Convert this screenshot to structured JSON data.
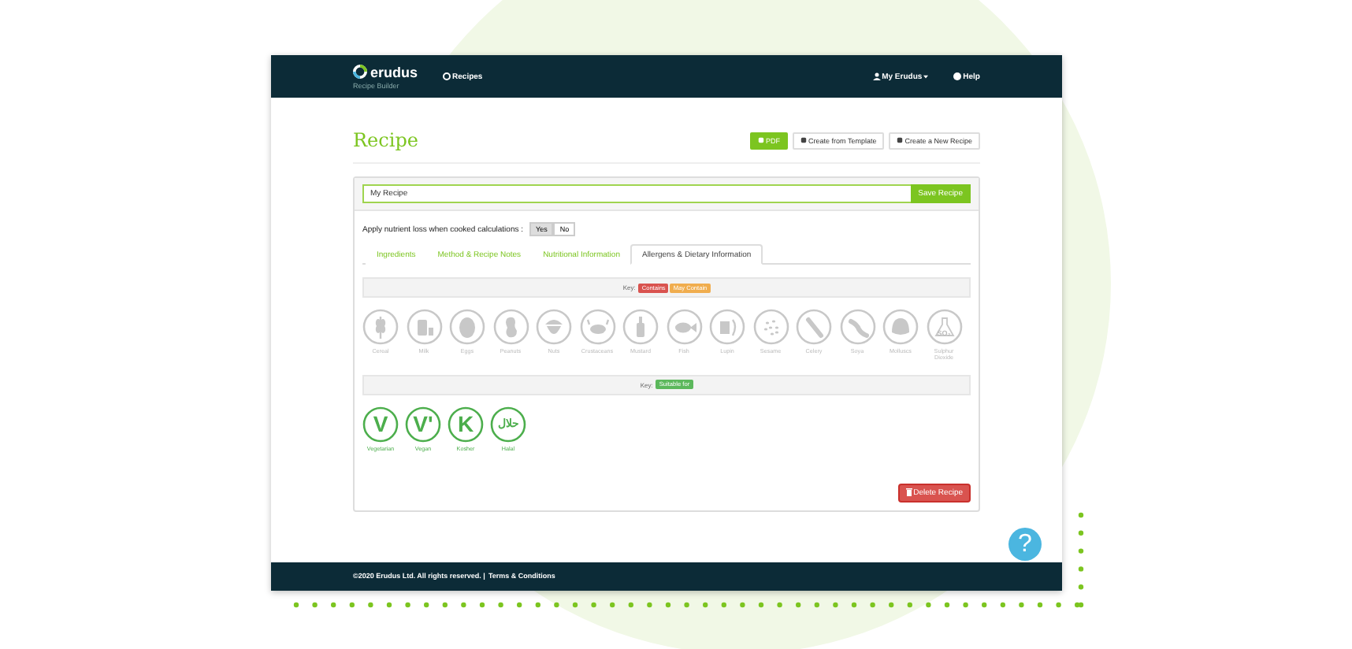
{
  "header": {
    "brand": "erudus",
    "subtitle": "Recipe Builder",
    "nav": [
      {
        "label": "Recipes"
      }
    ],
    "user_menu": "My Erudus",
    "help": "Help"
  },
  "page": {
    "title": "Recipe",
    "actions": [
      {
        "label": "PDF",
        "kind": "primary"
      },
      {
        "label": "Create from Template",
        "kind": "default"
      },
      {
        "label": "Create a New Recipe",
        "kind": "default"
      }
    ]
  },
  "recipe": {
    "name": "My Recipe",
    "save": "Save Recipe"
  },
  "nutrient_loss": {
    "label": "Apply nutrient loss when cooked calculations :",
    "options": [
      {
        "label": "Yes",
        "selected": true
      },
      {
        "label": "No",
        "selected": false
      }
    ]
  },
  "tabs": [
    {
      "label": "Ingredients",
      "selected": false
    },
    {
      "label": "Method & Recipe Notes",
      "selected": false
    },
    {
      "label": "Nutritional Information",
      "selected": false
    },
    {
      "label": "Allergens & Dietary Information",
      "selected": true
    }
  ],
  "allergen_key": {
    "label": "Key:",
    "tags": [
      {
        "label": "Contains",
        "color": "#d9534f"
      },
      {
        "label": "May Contain",
        "color": "#f0ad4e"
      }
    ]
  },
  "allergens": [
    {
      "label": "Cereal",
      "kind": "cereal"
    },
    {
      "label": "Milk",
      "kind": "milk"
    },
    {
      "label": "Eggs",
      "kind": "eggs"
    },
    {
      "label": "Peanuts",
      "kind": "peanuts"
    },
    {
      "label": "Nuts",
      "kind": "nuts"
    },
    {
      "label": "Crustaceans",
      "kind": "crustaceans"
    },
    {
      "label": "Mustard",
      "kind": "mustard"
    },
    {
      "label": "Fish",
      "kind": "fish"
    },
    {
      "label": "Lupin",
      "kind": "lupin"
    },
    {
      "label": "Sesame",
      "kind": "sesame"
    },
    {
      "label": "Celery",
      "kind": "celery"
    },
    {
      "label": "Soya",
      "kind": "soya"
    },
    {
      "label": "Molluscs",
      "kind": "molluscs"
    },
    {
      "label": "Sulphur Dioxide",
      "kind": "sulphur",
      "symbol": "SO₂"
    }
  ],
  "dietary_key": {
    "label": "Key:",
    "tags": [
      {
        "label": "Suitable for",
        "color": "#5cb85c"
      }
    ]
  },
  "dietary": [
    {
      "label": "Vegetarian",
      "symbol": "V"
    },
    {
      "label": "Vegan",
      "symbol": "V'"
    },
    {
      "label": "Kosher",
      "symbol": "K"
    },
    {
      "label": "Halal",
      "symbol": "حلال"
    }
  ],
  "delete": "Delete Recipe",
  "footer": {
    "copyright": "©2020 Erudus Ltd. All rights reserved. |",
    "link": "Terms & Conditions"
  },
  "help_bubble": "?"
}
